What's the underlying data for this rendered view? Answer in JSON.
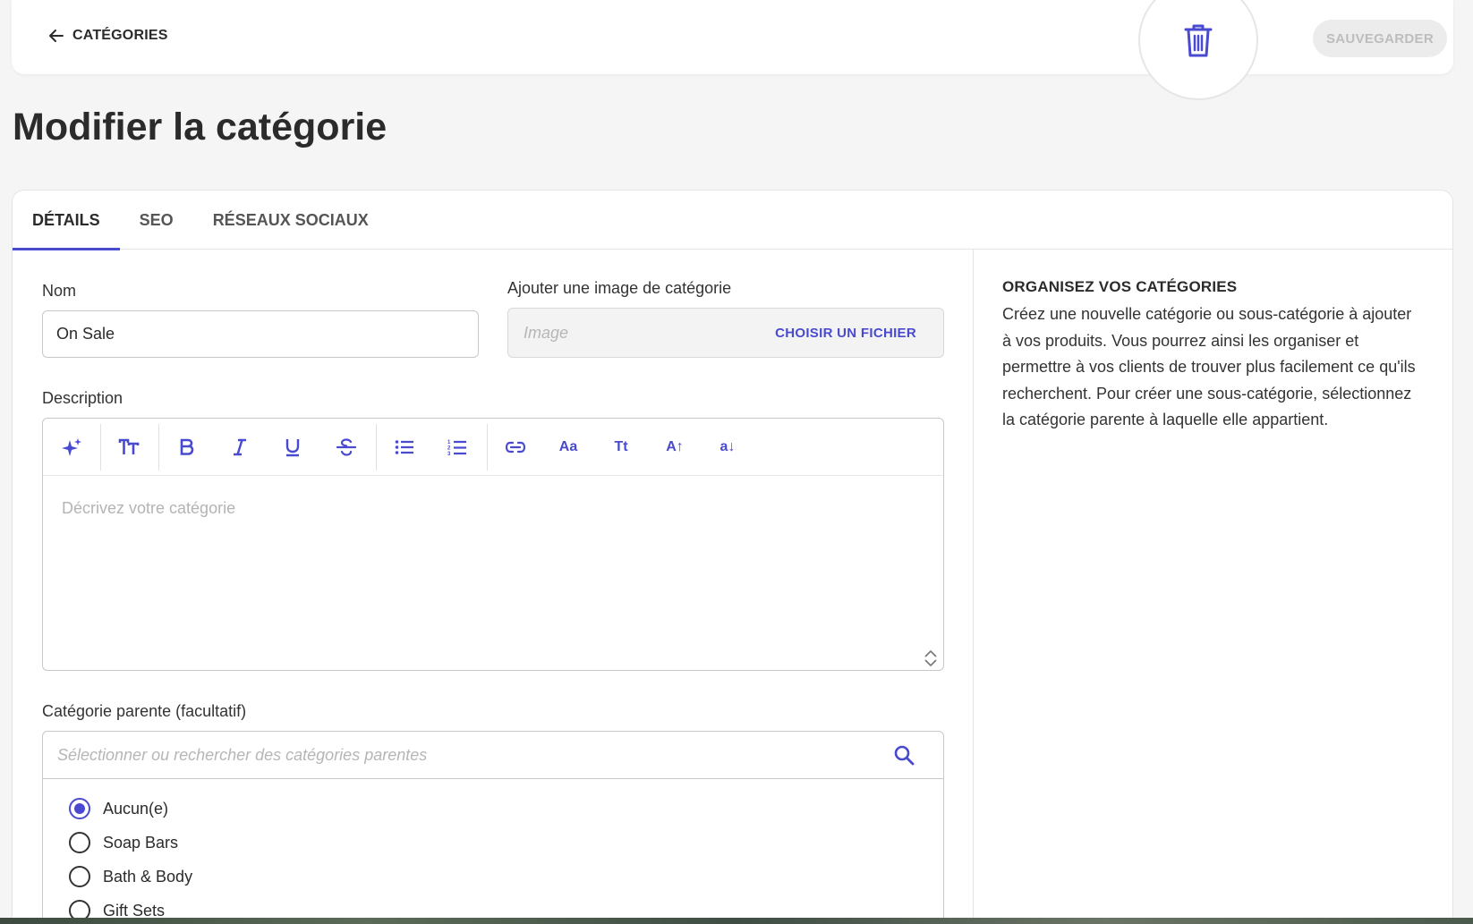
{
  "header": {
    "back_label": "CATÉGORIES",
    "save_label": "SAUVEGARDER"
  },
  "page": {
    "title": "Modifier la catégorie"
  },
  "tabs": [
    {
      "label": "DÉTAILS",
      "active": true
    },
    {
      "label": "SEO",
      "active": false
    },
    {
      "label": "RÉSEAUX SOCIAUX",
      "active": false
    }
  ],
  "form": {
    "name_label": "Nom",
    "name_value": "On Sale",
    "image_label": "Ajouter une image de catégorie",
    "image_placeholder": "Image",
    "image_button": "CHOISIR UN FICHIER",
    "description_label": "Description",
    "description_placeholder": "Décrivez votre catégorie",
    "toolbar": {
      "font_case_1": "Aa",
      "font_case_2": "Tt",
      "font_case_3": "A↑",
      "font_case_4": "a↓"
    },
    "parent_label": "Catégorie parente (facultatif)",
    "parent_placeholder": "Sélectionner ou rechercher des catégories parentes",
    "parent_options": [
      {
        "label": "Aucun(e)",
        "checked": true
      },
      {
        "label": "Soap Bars",
        "checked": false
      },
      {
        "label": "Bath & Body",
        "checked": false
      },
      {
        "label": "Gift Sets",
        "checked": false
      }
    ]
  },
  "info": {
    "title": "ORGANISEZ VOS CATÉGORIES",
    "text": "Créez une nouvelle catégorie ou sous-catégorie à ajouter à vos produits. Vous pourrez ainsi les organiser et permettre à vos clients de trouver plus facilement ce qu'ils recherchent. Pour créer une sous-catégorie, sélectionnez la catégorie parente à laquelle elle appartient."
  },
  "colors": {
    "accent": "#4a4ad0",
    "background": "#f5f5f5"
  },
  "icons": [
    "arrow-left-icon",
    "trash-icon",
    "sparkle-icon",
    "text-size-icon",
    "bold-icon",
    "italic-icon",
    "underline-icon",
    "strikethrough-icon",
    "bullet-list-icon",
    "numbered-list-icon",
    "link-icon",
    "search-icon",
    "resize-icon"
  ]
}
